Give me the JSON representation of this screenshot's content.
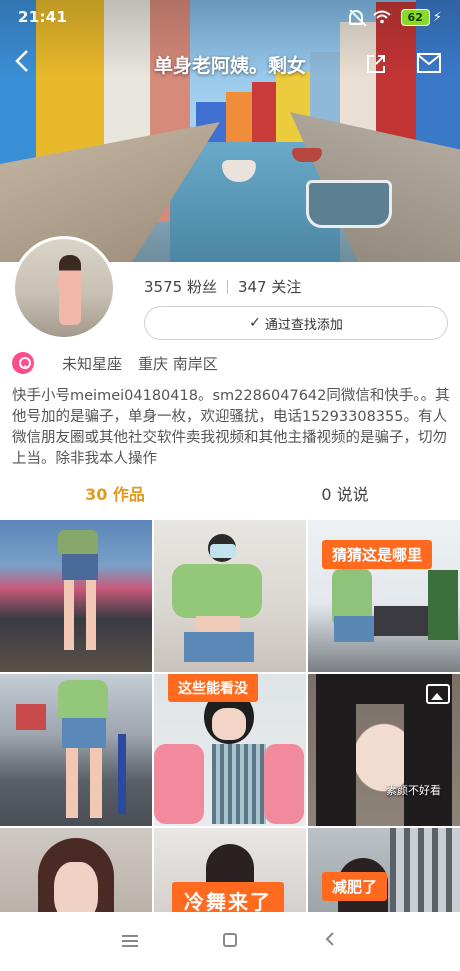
{
  "status_bar": {
    "time": "21:41",
    "battery": "62"
  },
  "header": {
    "title": "单身老阿姨。剩女"
  },
  "profile": {
    "followers": "3575 粉丝",
    "following": "347 关注",
    "add_button_check": "✓",
    "add_button_label": "通过查找添加",
    "constellation": "未知星座",
    "location": "重庆 南岸区",
    "bio": "快手小号meimei04180418。sm2286047642同微信和快手。。其他号加的是骗子，单身一枚，欢迎骚扰，电话15293308355。有人微信朋友圈或其他社交软件卖我视频和其他主播视频的是骗子，切勿上当。除非我本人操作"
  },
  "tabs": [
    {
      "label": "30 作品"
    },
    {
      "label": "0 说说"
    }
  ],
  "grid": [
    {
      "tag": ""
    },
    {
      "tag": ""
    },
    {
      "tag": "猜猜这是哪里"
    },
    {
      "tag": ""
    },
    {
      "tag": "这些能看没",
      "caption": ""
    },
    {
      "tag": "",
      "caption": "素颜不好看"
    },
    {
      "tag": ""
    },
    {
      "tag": "冷舞来了"
    },
    {
      "tag": "减肥了"
    }
  ],
  "colors": {
    "accent": "#e09a1f",
    "tag": "#ff6a1f",
    "pin": "#ff4d8c"
  }
}
